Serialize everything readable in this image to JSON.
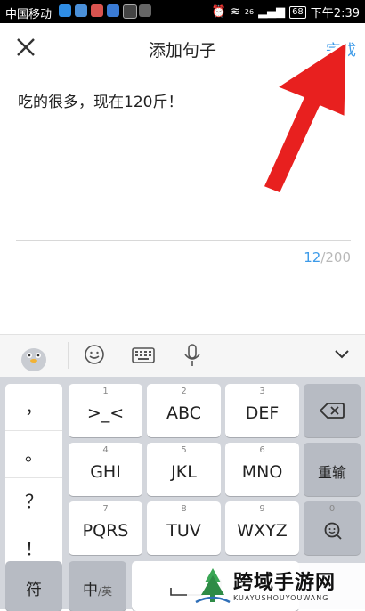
{
  "status_bar": {
    "carrier": "中国移动",
    "battery": "68",
    "time": "下午2:39",
    "network": "26"
  },
  "header": {
    "title": "添加句子",
    "done_label": "完成"
  },
  "editor": {
    "text": "吃的很多，现在120斤！",
    "count": "12",
    "max": "/200"
  },
  "keyboard": {
    "symbols": [
      "，",
      "。",
      "？",
      "！"
    ],
    "keys": [
      {
        "num": "1",
        "label": ">_<"
      },
      {
        "num": "2",
        "label": "ABC"
      },
      {
        "num": "3",
        "label": "DEF"
      },
      {
        "num": "4",
        "label": "GHI"
      },
      {
        "num": "5",
        "label": "JKL"
      },
      {
        "num": "6",
        "label": "MNO"
      },
      {
        "num": "7",
        "label": "PQRS"
      },
      {
        "num": "8",
        "label": "TUV"
      },
      {
        "num": "9",
        "label": "WXYZ"
      }
    ],
    "retype_label": "重输",
    "zero_num": "0",
    "symbol_key": "符",
    "lang_key_main": "中",
    "lang_key_sub": "/英"
  },
  "watermark": {
    "title": "跨域手游网",
    "subtitle": "KUAYUSHOUYOUWANG"
  },
  "colors": {
    "accent": "#3d9be9",
    "arrow": "#e8201f"
  }
}
